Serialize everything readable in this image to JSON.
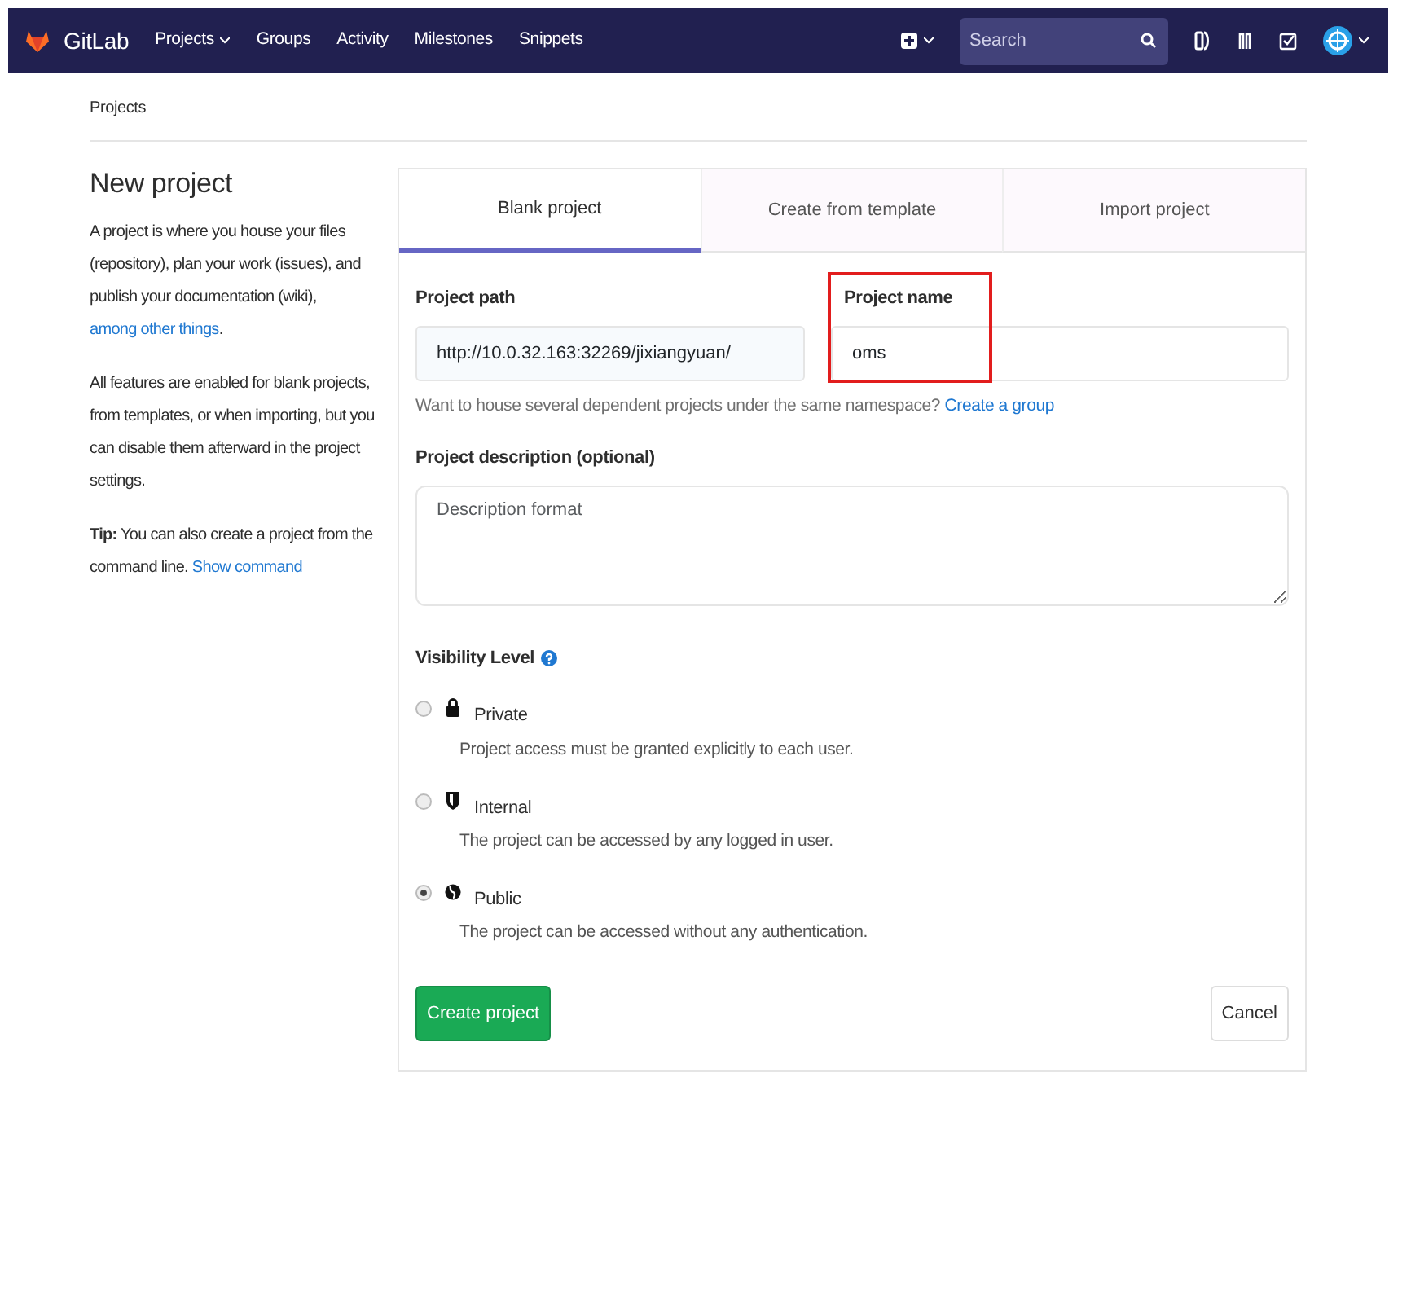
{
  "navbar": {
    "brand": "GitLab",
    "links": [
      {
        "label": "Projects",
        "dropdown": true
      },
      {
        "label": "Groups",
        "dropdown": false
      },
      {
        "label": "Activity",
        "dropdown": false
      },
      {
        "label": "Milestones",
        "dropdown": false
      },
      {
        "label": "Snippets",
        "dropdown": false
      }
    ],
    "search": {
      "placeholder": "Search"
    }
  },
  "breadcrumb": "Projects",
  "sidebar": {
    "title": "New project",
    "paragraphs": [
      {
        "text": "A project is where you house your files (repository), plan your work (issues), and publish your documentation (wiki), ",
        "link": "among other things",
        "after": "."
      },
      {
        "text": "All features are enabled for blank projects, from templates, or when importing, but you can disable them afterward in the project settings."
      },
      {
        "text": "**Tip:** You can also create a project from the command line. ",
        "link": "Show command"
      }
    ]
  },
  "tabs": [
    {
      "label": "Blank project",
      "selected": true
    },
    {
      "label": "Create from template",
      "selected": false
    },
    {
      "label": "Import project",
      "selected": false
    }
  ],
  "form": {
    "path_label": "Project path",
    "path_value": "http://10.0.32.163:32269/jixiangyuan/",
    "name_label": "Project name",
    "name_value": "oms",
    "name_highlighted": true,
    "help": "Want to house several dependent projects under the same namespace? ",
    "help_link": "Create a group",
    "description_label": "Project description (optional)",
    "description_placeholder": "Description format",
    "visibility_label": "Visibility Level",
    "visibility": [
      {
        "kind": "private",
        "label": "Private",
        "description": "Project access must be granted explicitly to each user.",
        "selected": false
      },
      {
        "kind": "internal",
        "label": "Internal",
        "description": "The project can be accessed by any logged in user.",
        "selected": false
      },
      {
        "kind": "public",
        "label": "Public",
        "description": "The project can be accessed without any authentication.",
        "selected": true
      }
    ],
    "submit": "Create project",
    "cancel": "Cancel"
  }
}
